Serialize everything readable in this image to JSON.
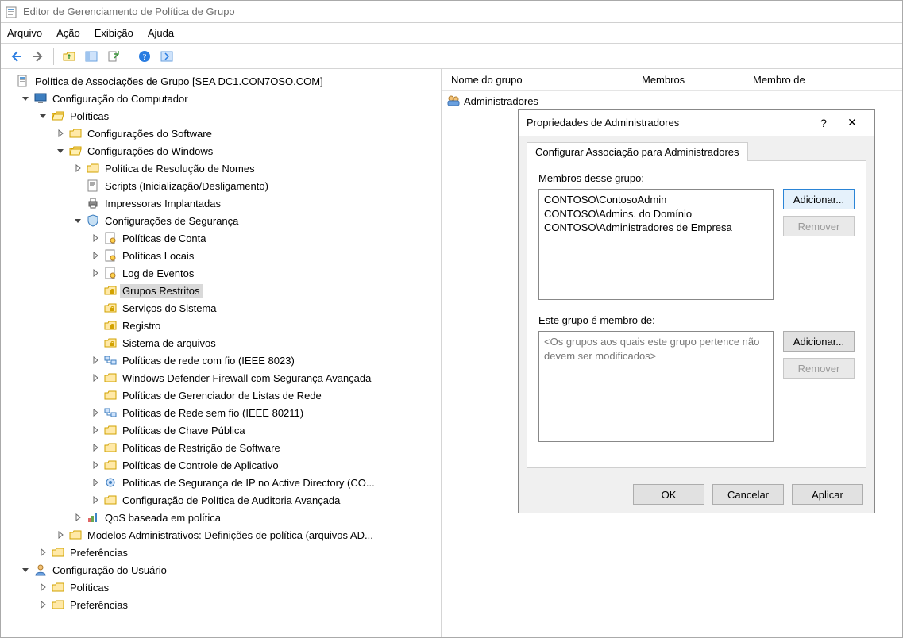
{
  "window": {
    "title": "Editor de Gerenciamento de Política de Grupo"
  },
  "menubar": {
    "file": "Arquivo",
    "action": "Ação",
    "view": "Exibição",
    "help": "Ajuda"
  },
  "tree": {
    "root": "Política de Associações de Grupo [SEA DC1.CON7OSO.COM]",
    "computer_config": "Configuração do Computador",
    "policies": "Políticas",
    "software_settings": "Configurações do Software",
    "windows_settings": "Configurações do Windows",
    "name_resolution": "Política de Resolução de Nomes",
    "scripts": "Scripts (Inicialização/Desligamento)",
    "printers": "Impressoras Implantadas",
    "security_settings": "Configurações de Segurança",
    "account_policies": "Políticas de Conta",
    "local_policies": "Políticas Locais",
    "event_log": "Log de Eventos",
    "restricted_groups": "Grupos Restritos",
    "system_services": "Serviços do Sistema",
    "registry": "Registro",
    "filesystem": "Sistema de arquivos",
    "wired_policies": "Políticas de rede com fio (IEEE 8023)",
    "firewall": "Windows Defender Firewall com Segurança Avançada",
    "network_list": "Políticas de Gerenciador de Listas de Rede",
    "wireless_policies": "Políticas de Rede sem fio (IEEE 80211)",
    "public_key": "Políticas de Chave Pública",
    "software_restriction": "Políticas de Restrição de Software",
    "app_control": "Políticas de Controle de Aplicativo",
    "ipsec": "Políticas de Segurança de IP no Active Directory (CO...",
    "audit_config": "Configuração de Política de Auditoria Avançada",
    "qos": "QoS baseada em política",
    "admin_templates": "Modelos Administrativos: Definições de política (arquivos AD...",
    "preferences": "Preferências",
    "user_config": "Configuração do Usuário",
    "user_policies": "Políticas",
    "user_preferences": "Preferências"
  },
  "list": {
    "col_group_name": "Nome do grupo",
    "col_members": "Membros",
    "col_member_of": "Membro de",
    "row0": "Administradores"
  },
  "dialog": {
    "title": "Propriedades de Administradores",
    "tab": "Configurar Associação para Administradores",
    "members_label": "Membros desse grupo:",
    "members": [
      "CONTOSO\\ContosoAdmin",
      "CONTOSO\\Admins. do Domínio",
      "CONTOSO\\Administradores de Empresa"
    ],
    "memberof_label": "Este grupo é membro de:",
    "memberof_placeholder": "<Os grupos aos quais este grupo pertence não devem ser modificados>",
    "add": "Adicionar...",
    "remove": "Remover",
    "ok": "OK",
    "cancel": "Cancelar",
    "apply": "Aplicar",
    "help": "?",
    "close": "✕"
  }
}
